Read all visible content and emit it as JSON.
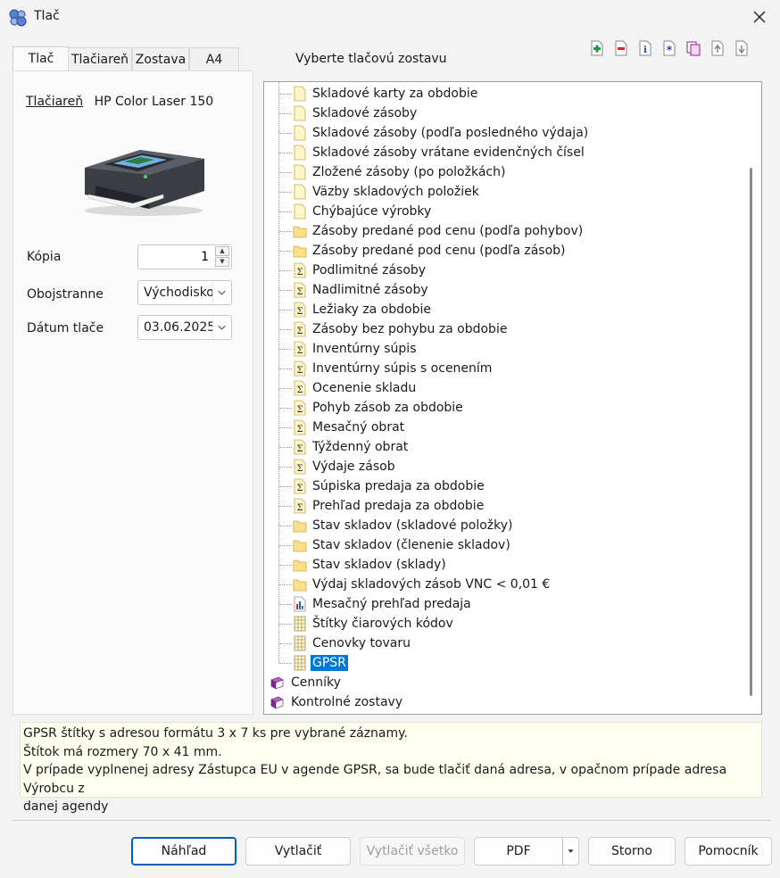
{
  "window": {
    "title": "Tlač"
  },
  "tabs": [
    {
      "label": "Tlač"
    },
    {
      "label": "Tlačiareň"
    },
    {
      "label": "Zostava"
    },
    {
      "label": "A4"
    }
  ],
  "left": {
    "printer_link": "Tlačiareň",
    "printer_name": "HP Color Laser 150",
    "copies_label": "Kópia",
    "copies_value": "1",
    "duplex_label": "Obojstranne",
    "duplex_value": "Východiskový",
    "date_label": "Dátum tlače",
    "date_value": "03.06.2025"
  },
  "report_section": {
    "title": "Vyberte tlačovú zostavu"
  },
  "toolbar_icons": [
    "add-icon",
    "remove-icon",
    "info-icon",
    "asterisk-icon",
    "copy-icon",
    "move-up-icon",
    "move-down-icon"
  ],
  "tree": {
    "items": [
      {
        "label": "Skladové karty za obdobie",
        "icon": "document-icon"
      },
      {
        "label": "Skladové zásoby",
        "icon": "document-icon"
      },
      {
        "label": "Skladové zásoby (podľa posledného výdaja)",
        "icon": "document-icon"
      },
      {
        "label": "Skladové zásoby vrátane evidenčných čísel",
        "icon": "document-icon"
      },
      {
        "label": "Zložené zásoby (po položkách)",
        "icon": "document-icon"
      },
      {
        "label": "Väzby skladových položiek",
        "icon": "document-icon"
      },
      {
        "label": "Chýbajúce výrobky",
        "icon": "document-icon"
      },
      {
        "label": "Zásoby predané pod cenu (podľa pohybov)",
        "icon": "folder-icon"
      },
      {
        "label": "Zásoby predané pod cenu (podľa zásob)",
        "icon": "folder-icon"
      },
      {
        "label": "Podlimitné zásoby",
        "icon": "sum-document-icon"
      },
      {
        "label": "Nadlimitné zásoby",
        "icon": "sum-document-icon"
      },
      {
        "label": "Ležiaky za obdobie",
        "icon": "sum-document-icon"
      },
      {
        "label": "Zásoby bez pohybu za obdobie",
        "icon": "sum-document-icon"
      },
      {
        "label": "Inventúrny súpis",
        "icon": "sum-document-icon"
      },
      {
        "label": "Inventúrny súpis s ocenením",
        "icon": "sum-document-icon"
      },
      {
        "label": "Ocenenie skladu",
        "icon": "sum-document-icon"
      },
      {
        "label": "Pohyb zásob za obdobie",
        "icon": "sum-document-icon"
      },
      {
        "label": "Mesačný obrat",
        "icon": "sum-document-icon"
      },
      {
        "label": "Týždenný obrat",
        "icon": "sum-document-icon"
      },
      {
        "label": "Výdaje zásob",
        "icon": "sum-document-icon"
      },
      {
        "label": "Súpiska predaja za obdobie",
        "icon": "sum-document-icon"
      },
      {
        "label": "Prehľad predaja za obdobie",
        "icon": "sum-document-icon"
      },
      {
        "label": "Stav skladov (skladové položky)",
        "icon": "folder-icon"
      },
      {
        "label": "Stav skladov (členenie skladov)",
        "icon": "folder-icon"
      },
      {
        "label": "Stav skladov (sklady)",
        "icon": "folder-icon"
      },
      {
        "label": "Výdaj skladových zásob VNC < 0,01 €",
        "icon": "folder-icon"
      },
      {
        "label": "Mesačný prehľad predaja",
        "icon": "chart-document-icon"
      },
      {
        "label": "Štítky čiarových kódov",
        "icon": "grid-document-icon"
      },
      {
        "label": "Cenovky tovaru",
        "icon": "grid-document-icon"
      },
      {
        "label": "GPSR",
        "icon": "grid-document-icon",
        "selected": true
      }
    ],
    "groups": [
      {
        "label": "Cenníky",
        "icon": "book-icon"
      },
      {
        "label": "Kontrolné zostavy",
        "icon": "book-icon"
      }
    ]
  },
  "description": {
    "lines": [
      "GPSR štítky s adresou formátu 3 x 7 ks pre vybrané záznamy.",
      "Štítok má rozmery 70 x 41 mm.",
      "V prípade vyplnenej adresy Zástupca EU v agende GPSR, sa bude tlačiť daná adresa, v opačnom prípade adresa Výrobcu z",
      "danej agendy"
    ]
  },
  "buttons": {
    "preview": "Náhľad",
    "print": "Vytlačiť",
    "print_all": "Vytlačiť všetko",
    "pdf": "PDF",
    "cancel": "Storno",
    "help": "Pomocník"
  },
  "colors": {
    "selection": "#0078d7",
    "folder": "#fbe08a",
    "book": "#7a2a8a"
  }
}
